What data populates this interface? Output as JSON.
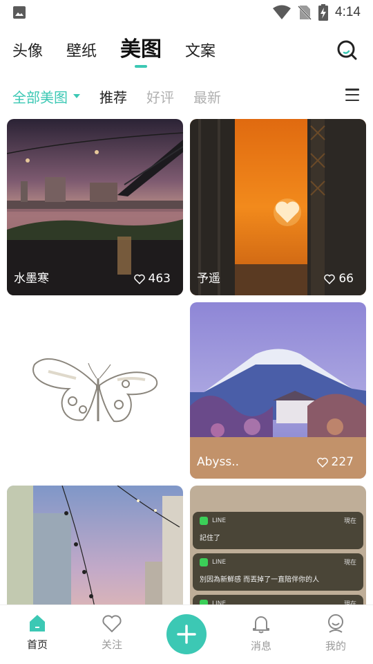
{
  "status": {
    "time": "4:14",
    "icons": [
      "image-icon",
      "wifi-icon",
      "no-sim-icon",
      "battery-charging-icon"
    ]
  },
  "top_tabs": [
    {
      "label": "头像",
      "active": false
    },
    {
      "label": "壁纸",
      "active": false
    },
    {
      "label": "美图",
      "active": true
    },
    {
      "label": "文案",
      "active": false
    }
  ],
  "filters": [
    {
      "label": "全部美图",
      "active": true
    },
    {
      "label": "推荐",
      "active": false
    },
    {
      "label": "好评",
      "active": false
    },
    {
      "label": "最新",
      "active": false
    }
  ],
  "cards": [
    {
      "author": "水墨寒",
      "likes": "463"
    },
    {
      "author": "予遥",
      "likes": "66"
    },
    {
      "author": "",
      "likes": ""
    },
    {
      "author": "Abyss..",
      "likes": "227"
    }
  ],
  "notifications": [
    {
      "app": "LINE",
      "time": "現在",
      "message": "記住了"
    },
    {
      "app": "LINE",
      "time": "現在",
      "message": "別因為新鮮感 而丟掉了一直陪伴你的人"
    },
    {
      "app": "LINE",
      "time": "現在",
      "message": ""
    }
  ],
  "bottom_nav": [
    {
      "label": "首页",
      "active": true
    },
    {
      "label": "关注",
      "active": false
    },
    {
      "label": "消息",
      "active": false
    },
    {
      "label": "我的",
      "active": false
    }
  ],
  "colors": {
    "accent": "#3cc8b4"
  }
}
